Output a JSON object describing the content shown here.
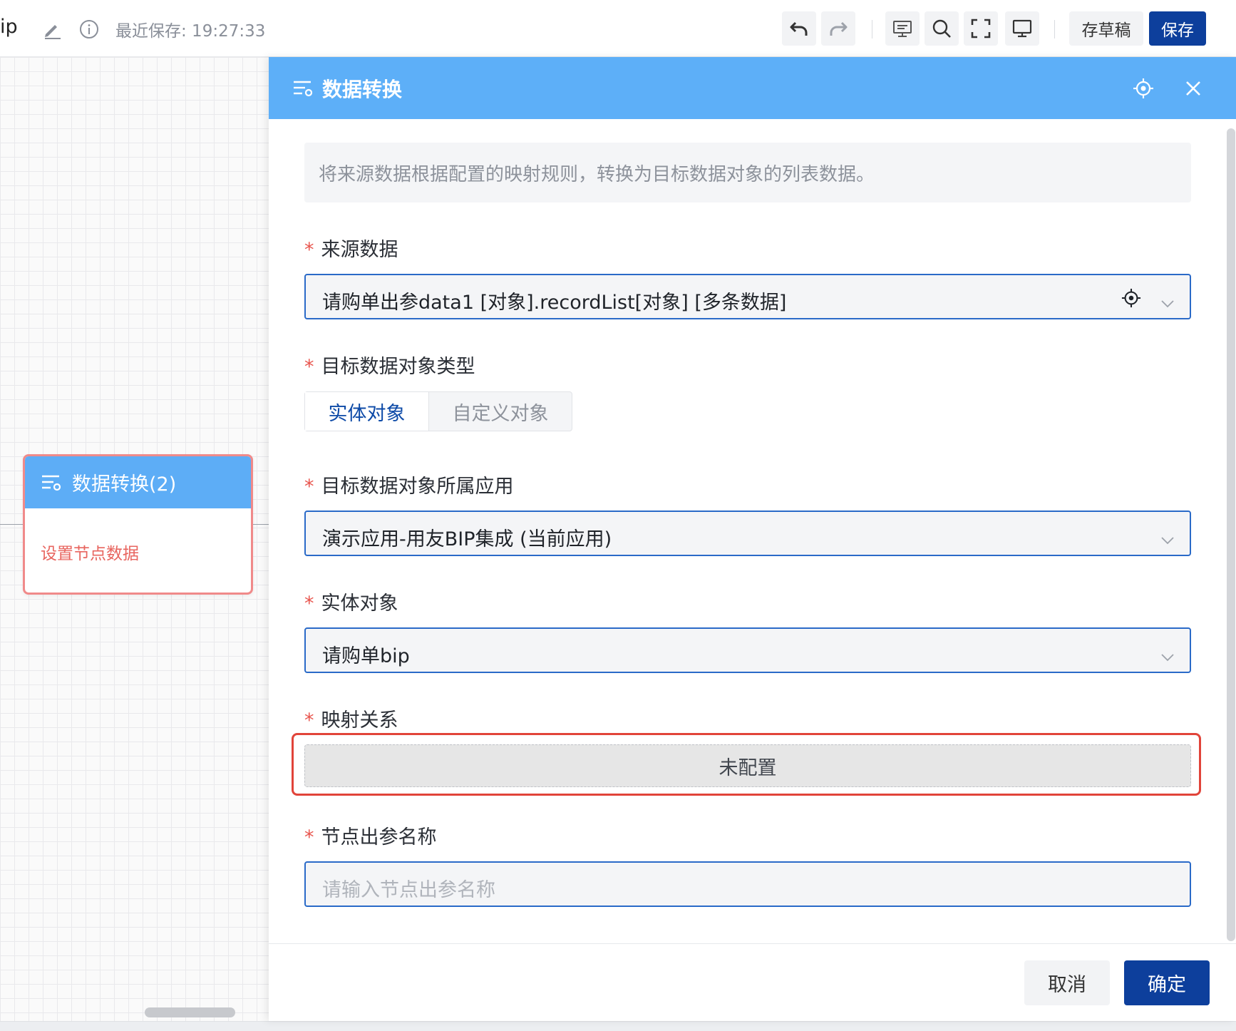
{
  "toolbar": {
    "title_fragment": "ip",
    "last_saved": "最近保存: 19:27:33",
    "draft_label": "存草稿",
    "save_label": "保存"
  },
  "canvas_node": {
    "title": "数据转换(2)",
    "body_text": "设置节点数据"
  },
  "drawer": {
    "title": "数据转换",
    "description": "将来源数据根据配置的映射规则，转换为目标数据对象的列表数据。",
    "fields": {
      "source": {
        "label": "来源数据",
        "value": "请购单出参data1 [对象].recordList[对象] [多条数据]"
      },
      "target_type": {
        "label": "目标数据对象类型",
        "options": [
          "实体对象",
          "自定义对象"
        ],
        "selected": "实体对象"
      },
      "target_app": {
        "label": "目标数据对象所属应用",
        "value": "演示应用-用友BIP集成 (当前应用)"
      },
      "entity": {
        "label": "实体对象",
        "value": "请购单bip"
      },
      "mapping": {
        "label": "映射关系",
        "button_label": "未配置"
      },
      "output_name": {
        "label": "节点出参名称",
        "placeholder": "请输入节点出参名称"
      }
    },
    "required_mark": "*",
    "cancel_label": "取消",
    "confirm_label": "确定"
  },
  "colors": {
    "header_blue": "#5daff8",
    "primary": "#0d3f9c",
    "required": "#e8554e",
    "highlight_outline": "#e1443a"
  },
  "icons": [
    "edit-icon",
    "info-icon",
    "undo-icon",
    "redo-icon",
    "preview-icon",
    "search-icon",
    "fullscreen-icon",
    "monitor-icon",
    "node-type-icon",
    "locate-icon",
    "close-icon",
    "chevron-down-icon"
  ]
}
